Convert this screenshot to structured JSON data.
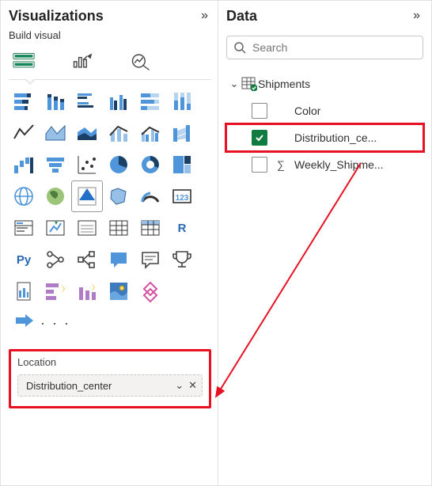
{
  "viz_pane": {
    "title": "Visualizations",
    "collapse_glyph": "»",
    "subhead": "Build visual",
    "tabs": {
      "build": "build",
      "format": "format",
      "analytics": "analytics"
    },
    "more_glyph": "· · ·"
  },
  "field_well": {
    "label": "Location",
    "item": "Distribution_center",
    "caret": "⌄",
    "close": "✕"
  },
  "data_pane": {
    "title": "Data",
    "collapse_glyph": "»",
    "search_placeholder": "Search",
    "table": {
      "name": "Shipments",
      "expanded_glyph": "⌄",
      "fields": [
        {
          "name": "Color",
          "checked": false,
          "agg": false,
          "highlight": false
        },
        {
          "name": "Distribution_ce...",
          "checked": true,
          "agg": false,
          "highlight": true
        },
        {
          "name": "Weekly_Shipme...",
          "checked": false,
          "agg": true,
          "highlight": false
        }
      ]
    }
  }
}
